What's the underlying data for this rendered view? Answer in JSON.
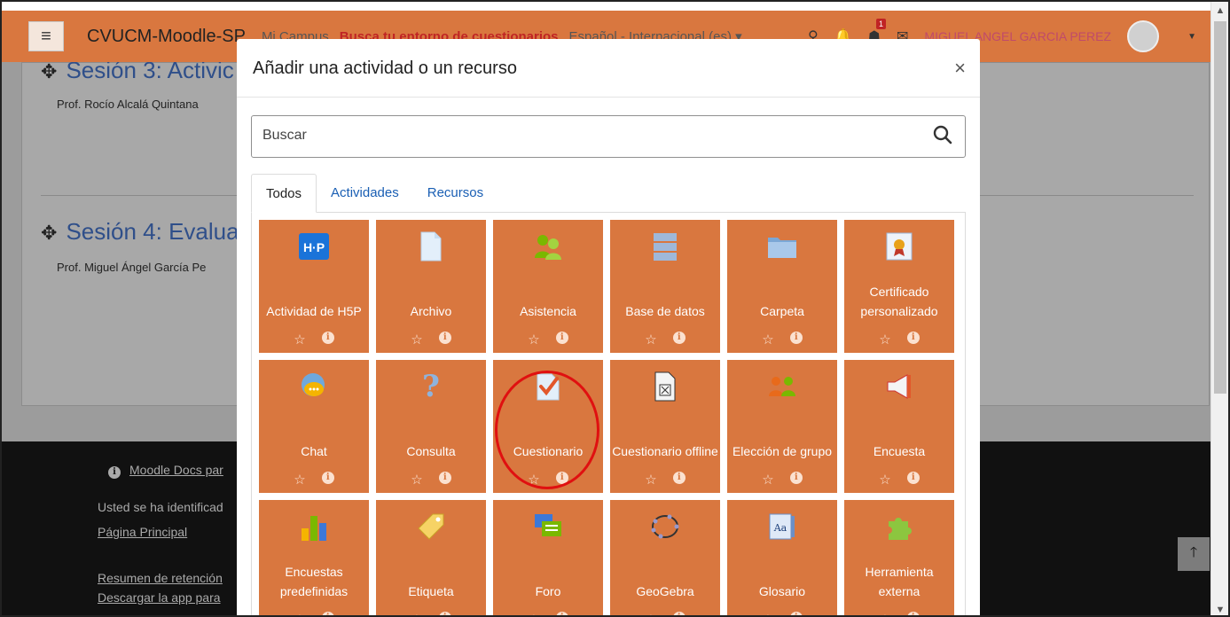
{
  "navbar": {
    "brand": "CVUCM-Moodle-SP",
    "mi_campus": "Mi Campus",
    "busca": "Busca tu entorno de cuestionarios",
    "language": "Español - Internacional (es) ▾",
    "notification_count": "1",
    "user_name": "MIGUEL ANGEL GARCIA PEREZ"
  },
  "sections": [
    {
      "title": "Sesión 3: Activic",
      "prof": "Prof. Rocío Alcalá Quintana"
    },
    {
      "title": "Sesión 4: Evalua",
      "prof": "Prof. Miguel Ángel García Pe"
    }
  ],
  "footer": {
    "docs": "Moodle Docs par",
    "identified": "Usted se ha identificad",
    "home": "Página Principal",
    "retention": "Resumen de retención",
    "app": "Descargar la app para"
  },
  "modal": {
    "title": "Añadir una actividad o un recurso",
    "close": "×",
    "search_placeholder": "Buscar",
    "tabs": [
      "Todos",
      "Actividades",
      "Recursos"
    ]
  },
  "tiles": [
    {
      "label": "Actividad de H5P",
      "icon": "h5p-icon"
    },
    {
      "label": "Archivo",
      "icon": "file-icon"
    },
    {
      "label": "Asistencia",
      "icon": "attendance-icon"
    },
    {
      "label": "Base de datos",
      "icon": "database-icon"
    },
    {
      "label": "Carpeta",
      "icon": "folder-icon"
    },
    {
      "label": "Certificado personalizado",
      "icon": "certificate-icon"
    },
    {
      "label": "Chat",
      "icon": "chat-icon"
    },
    {
      "label": "Consulta",
      "icon": "question-icon"
    },
    {
      "label": "Cuestionario",
      "icon": "quiz-icon"
    },
    {
      "label": "Cuestionario offline",
      "icon": "offline-quiz-icon"
    },
    {
      "label": "Elección de grupo",
      "icon": "group-choice-icon"
    },
    {
      "label": "Encuesta",
      "icon": "megaphone-icon"
    },
    {
      "label": "Encuestas predefinidas",
      "icon": "bar-chart-icon"
    },
    {
      "label": "Etiqueta",
      "icon": "label-tag-icon"
    },
    {
      "label": "Foro",
      "icon": "forum-icon"
    },
    {
      "label": "GeoGebra",
      "icon": "geogebra-icon"
    },
    {
      "label": "Glosario",
      "icon": "glossary-icon"
    },
    {
      "label": "Herramienta externa",
      "icon": "puzzle-icon"
    }
  ],
  "colors": {
    "navbar": "#d9773f",
    "tile": "#d9773f",
    "highlight_circle": "#e01010"
  }
}
